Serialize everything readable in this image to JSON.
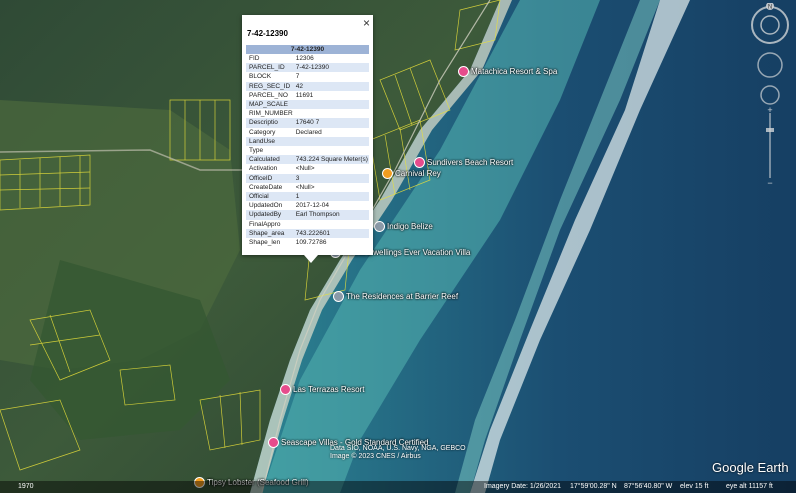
{
  "popup": {
    "title": "7-42-12390",
    "table_header": "7-42-12390",
    "close_glyph": "×",
    "rows": [
      [
        "FID",
        "12306"
      ],
      [
        "PARCEL_ID",
        "7-42-12390"
      ],
      [
        "BLOCK",
        "7"
      ],
      [
        "REG_SEC_ID",
        "42"
      ],
      [
        "PARCEL_NO",
        "11691"
      ],
      [
        "MAP_SCALE",
        ""
      ],
      [
        "RIM_NUMBER",
        ""
      ],
      [
        "Descriptio",
        "17640 7"
      ],
      [
        "Category",
        "Declared"
      ],
      [
        "LandUse",
        ""
      ],
      [
        "Type",
        ""
      ],
      [
        "Calculated",
        "743.224 Square Meter(s)"
      ],
      [
        "Activation",
        "<Null>"
      ],
      [
        "OfficeID",
        "3"
      ],
      [
        "CreateDate",
        "<Null>"
      ],
      [
        "Official",
        "1"
      ],
      [
        "UpdatedOn",
        "2017-12-04"
      ],
      [
        "UpdatedBy",
        "Earl Thompson"
      ],
      [
        "FinalAppro",
        ""
      ],
      [
        "Shape_area",
        "743.222601"
      ],
      [
        "Shape_len",
        "109.72786"
      ]
    ]
  },
  "places": {
    "p1": "Matachica Resort & Spa",
    "p2": "Sundivers Beach Resort",
    "p3": "Carnival Rey",
    "p4": "Indigo Belize",
    "p5": "Sweet Dwellings Ever Vacation Villa",
    "p6": "The Residences at Barrier Reef",
    "p7": "Las Terrazas Resort",
    "p8": "Seascape Villas - Gold Standard Certified",
    "p9": "Tipsy Lobster (Seafood Grill)"
  },
  "credits": {
    "line1": "Data SIO, NOAA, U.S. Navy, NGA, GEBCO",
    "line2": "Image © 2023 CNES / Airbus"
  },
  "logo": "Google Earth",
  "status": {
    "year": "1970",
    "imagery_date": "Imagery Date: 1/26/2021",
    "lat": "17°59'00.28\" N",
    "lon": "87°56'40.80\" W",
    "elev": "elev   15 ft",
    "eye_alt": "eye alt  11157 ft"
  },
  "nav": {
    "north": "N"
  },
  "colors": {
    "pin_pink": "#e64c8c",
    "pin_food": "#f29d1f",
    "header_blue": "#9db3d6",
    "parcel_yellow": "#e8e03a"
  }
}
